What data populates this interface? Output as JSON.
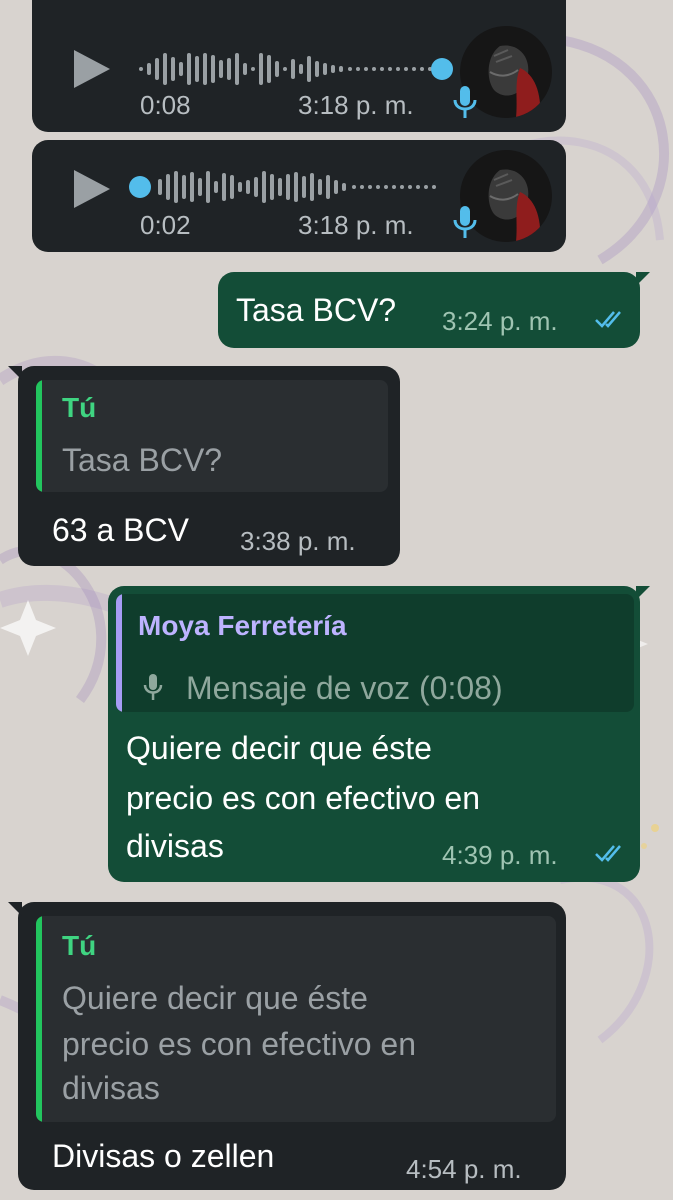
{
  "colors": {
    "incoming_bubble": "#1f2326",
    "outgoing_bubble": "#134d37",
    "quote_self_bar": "#22c55e",
    "quote_self_name": "#3fd481",
    "quote_contact_bar": "#a79cf4",
    "quote_contact_name": "#bdb3ff",
    "read_ticks": "#53bdeb",
    "voice_dot": "#53bdeb"
  },
  "messages": [
    {
      "type": "voice",
      "direction": "incoming",
      "duration": "0:08",
      "time": "3:18 p. m.",
      "icons": [
        "play-icon",
        "waveform",
        "avatar",
        "mic-icon"
      ]
    },
    {
      "type": "voice",
      "direction": "incoming",
      "duration": "0:02",
      "time": "3:18 p. m.",
      "icons": [
        "play-icon",
        "waveform",
        "avatar",
        "mic-icon"
      ]
    },
    {
      "type": "text",
      "direction": "outgoing",
      "text": "Tasa BCV?",
      "time": "3:24 p. m.",
      "status": "read"
    },
    {
      "type": "text",
      "direction": "incoming",
      "quote": {
        "author": "Tú",
        "text": "Tasa BCV?"
      },
      "text": "63 a BCV",
      "time": "3:38 p. m."
    },
    {
      "type": "text",
      "direction": "outgoing",
      "quote": {
        "author": "Moya Ferretería",
        "text": "Mensaje de voz (0:08)",
        "icon": "mic-icon"
      },
      "lines": [
        "Quiere decir que éste",
        "precio es con efectivo en",
        "divisas"
      ],
      "time": "4:39 p. m.",
      "status": "read"
    },
    {
      "type": "text",
      "direction": "incoming",
      "quote": {
        "author": "Tú",
        "lines": [
          "Quiere decir que éste",
          "precio es con efectivo en",
          "divisas"
        ]
      },
      "text": "Divisas o zellen",
      "time": "4:54 p. m."
    }
  ]
}
